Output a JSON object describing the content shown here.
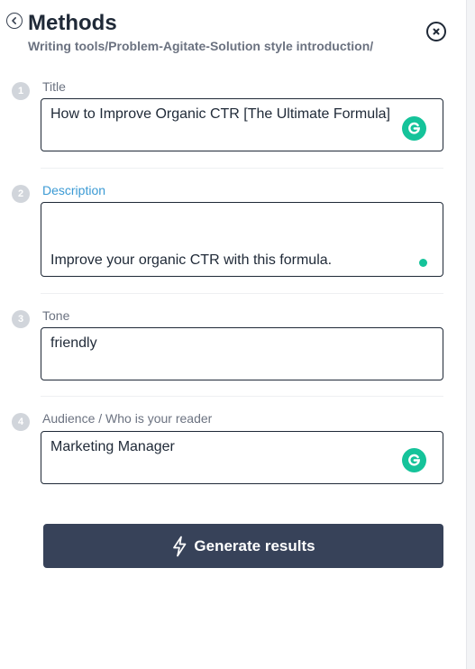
{
  "header": {
    "title": "Methods",
    "breadcrumb": "Writing tools/Problem-Agitate-Solution style introduction/"
  },
  "form": {
    "fields": [
      {
        "step": "1",
        "label": "Title",
        "value": "How to Improve Organic CTR [The Ultimate Formula]"
      },
      {
        "step": "2",
        "label": "Description",
        "value": "Improve your organic CTR with this formula."
      },
      {
        "step": "3",
        "label": "Tone",
        "value": "friendly"
      },
      {
        "step": "4",
        "label": "Audience / Who is your reader",
        "value": "Marketing Manager"
      }
    ]
  },
  "actions": {
    "generate_label": "Generate results"
  },
  "icons": {
    "back": "chevron-left-circle-icon",
    "close": "close-circle-icon",
    "grammarly": "grammarly-icon",
    "bolt": "lightning-bolt-icon"
  },
  "colors": {
    "accent_label": "#3b9ad4",
    "button_bg": "#374259",
    "grammarly_green": "#15c39a",
    "step_badge": "#d1d5db"
  }
}
